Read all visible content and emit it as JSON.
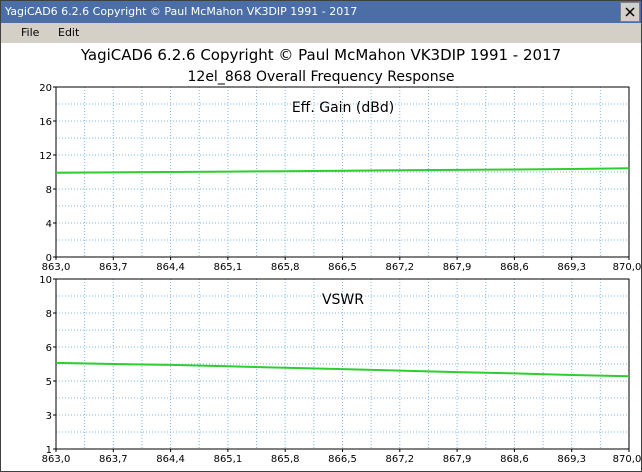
{
  "window": {
    "title": "YagiCAD6 6.2.6   Copyright © Paul McMahon VK3DIP 1991 - 2017"
  },
  "menu": {
    "file": "File",
    "edit": "Edit"
  },
  "header": {
    "line1": "YagiCAD6 6.2.6   Copyright © Paul McMahon VK3DIP 1991 - 2017",
    "line2": "12el_868 Overall Frequency Response"
  },
  "colors": {
    "grid": "#7fb7e6",
    "trace": "#2fcd2f",
    "titlebar": "#4a6ea5"
  },
  "chart_data": [
    {
      "type": "line",
      "title": "Eff. Gain (dBd)",
      "x": [
        863.0,
        863.7,
        864.4,
        865.1,
        865.8,
        866.5,
        867.2,
        867.9,
        868.6,
        869.3,
        870.0
      ],
      "x_tick_labels": [
        "863,0",
        "863,7",
        "864,4",
        "865,1",
        "865,8",
        "866,5",
        "867,2",
        "867,9",
        "868,6",
        "869,3",
        "870,0"
      ],
      "y_tick_labels": [
        "0",
        "4",
        "8",
        "12",
        "16",
        "20"
      ],
      "ylim": [
        0,
        20
      ],
      "series": [
        {
          "values": [
            9.9,
            9.95,
            10.0,
            10.05,
            10.1,
            10.15,
            10.2,
            10.25,
            10.3,
            10.35,
            10.45
          ]
        }
      ],
      "grid": true
    },
    {
      "type": "line",
      "title": "VSWR",
      "x": [
        863.0,
        863.7,
        864.4,
        865.1,
        865.8,
        866.5,
        867.2,
        867.9,
        868.6,
        869.3,
        870.0
      ],
      "x_tick_labels": [
        "863,0",
        "863,7",
        "864,4",
        "865,1",
        "865,8",
        "866,5",
        "867,2",
        "867,9",
        "868,6",
        "869,3",
        "870,0"
      ],
      "y_tick_labels": [
        "1",
        "3",
        "5",
        "6",
        "8",
        "10"
      ],
      "ylim": [
        1,
        10
      ],
      "series": [
        {
          "values": [
            5.56,
            5.5,
            5.45,
            5.38,
            5.3,
            5.23,
            5.15,
            5.07,
            5.0,
            4.92,
            4.85
          ]
        }
      ],
      "grid": true
    }
  ]
}
